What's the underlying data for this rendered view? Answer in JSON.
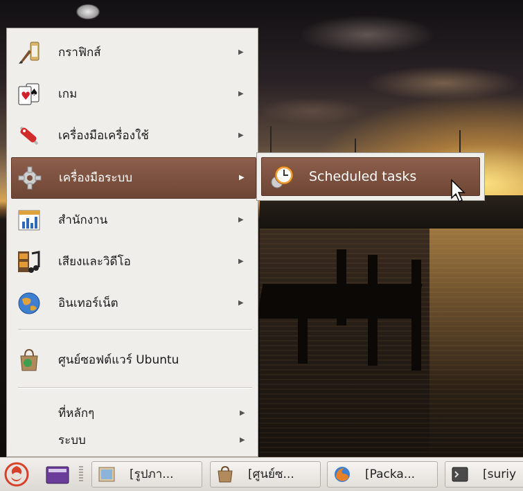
{
  "menu": {
    "items": [
      {
        "label": "กราฟิกส์",
        "icon": "graphics-icon",
        "has_submenu": true
      },
      {
        "label": "เกม",
        "icon": "games-icon",
        "has_submenu": true
      },
      {
        "label": "เครื่องมือเครื่องใช้",
        "icon": "accessories-icon",
        "has_submenu": true
      },
      {
        "label": "เครื่องมือระบบ",
        "icon": "system-tools-icon",
        "has_submenu": true
      },
      {
        "label": "สำนักงาน",
        "icon": "office-icon",
        "has_submenu": true
      },
      {
        "label": "เสียงและวิดีโอ",
        "icon": "sound-video-icon",
        "has_submenu": true
      },
      {
        "label": "อินเทอร์เน็ต",
        "icon": "internet-icon",
        "has_submenu": true
      }
    ],
    "software_center": {
      "label": "ศูนย์ซอฟต์แวร์ Ubuntu",
      "icon": "software-center-icon"
    },
    "places": {
      "label": "ที่หลักๆ"
    },
    "system": {
      "label": "ระบบ"
    },
    "arrow": "▶"
  },
  "submenu": {
    "item": {
      "label": "Scheduled tasks",
      "icon": "scheduled-tasks-icon"
    }
  },
  "taskbar": {
    "tasks": [
      {
        "label": "[รูปภา...",
        "icon": "image-viewer-icon"
      },
      {
        "label": "[ศูนย์ซ...",
        "icon": "software-center-icon"
      },
      {
        "label": "[Packa...",
        "icon": "firefox-icon"
      },
      {
        "label": "[suriy",
        "icon": "terminal-icon"
      }
    ]
  },
  "colors": {
    "menu_bg": "#f0eeeb",
    "highlight": "#7b4f3e",
    "taskbar_bg": "#e6e3df"
  }
}
